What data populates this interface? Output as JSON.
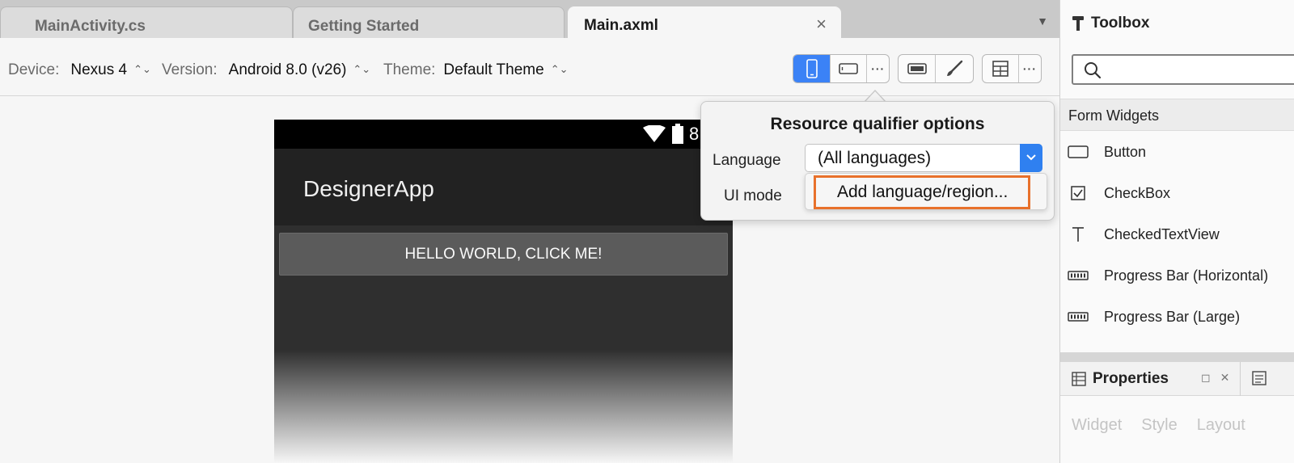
{
  "tabs": [
    {
      "label": "MainActivity.cs",
      "active": false
    },
    {
      "label": "Getting Started",
      "active": false
    },
    {
      "label": "Main.axml",
      "active": true,
      "close": "×"
    }
  ],
  "toolbar": {
    "device_label": "Device:",
    "device_value": "Nexus 4",
    "version_label": "Version:",
    "version_value": "Android 8.0 (v26)",
    "theme_label": "Theme:",
    "theme_value": "Default Theme",
    "more": "···"
  },
  "device": {
    "status_text": "8",
    "app_title": "DesignerApp",
    "button_text": "HELLO WORLD, CLICK ME!"
  },
  "popover": {
    "title": "Resource qualifier options",
    "language_label": "Language",
    "language_value": "(All languages)",
    "ui_mode_label": "UI mode",
    "menu_item": "Add language/region..."
  },
  "toolbox": {
    "title": "Toolbox",
    "category": "Form Widgets",
    "items": [
      {
        "label": "Button",
        "icon": "button-icon"
      },
      {
        "label": "CheckBox",
        "icon": "checkbox-icon"
      },
      {
        "label": "CheckedTextView",
        "icon": "text-icon"
      },
      {
        "label": "Progress Bar (Horizontal)",
        "icon": "progressbar-icon"
      },
      {
        "label": "Progress Bar (Large)",
        "icon": "progressbar-icon"
      }
    ]
  },
  "properties": {
    "title": "Properties",
    "tabs": [
      "Widget",
      "Style",
      "Layout"
    ]
  },
  "colors": {
    "accent": "#3b82f6",
    "highlight": "#e8712b"
  }
}
